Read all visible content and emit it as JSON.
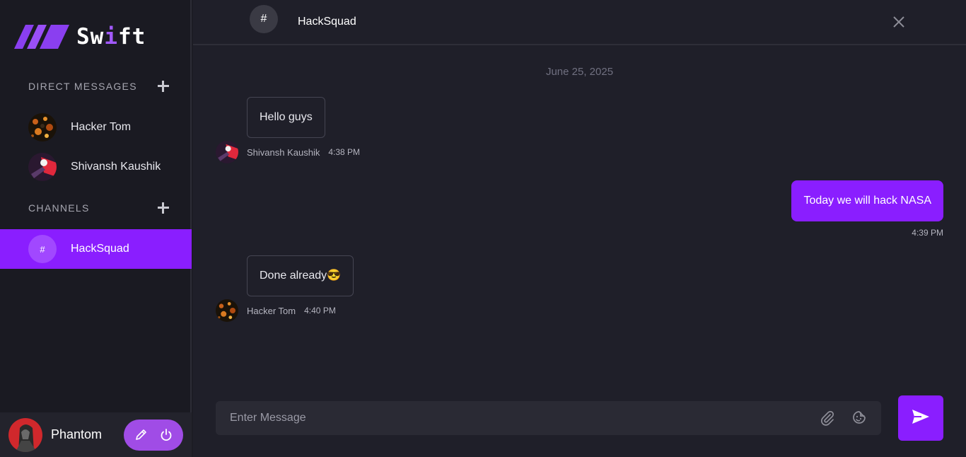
{
  "app": {
    "logo_prefix": "Sw",
    "logo_accent": "i",
    "logo_suffix": "ft",
    "accent_color": "#8a1eff"
  },
  "sidebar": {
    "direct_messages_title": "DIRECT MESSAGES",
    "dms": [
      {
        "name": "Hacker Tom",
        "avatar": "hacker-tom-avatar"
      },
      {
        "name": "Shivansh Kaushik",
        "avatar": "shivansh-avatar"
      }
    ],
    "channels_title": "CHANNELS",
    "channels": [
      {
        "icon": "#",
        "name": "HackSquad",
        "active": true
      }
    ],
    "user": {
      "name": "Phantom",
      "avatar": "phantom-avatar"
    }
  },
  "chat": {
    "header_icon": "#",
    "header_title": "HackSquad",
    "date": "June 25, 2025",
    "messages": [
      {
        "text": "Hello guys",
        "sender": "Shivansh Kaushik",
        "time": "4:38 PM",
        "outgoing": false
      },
      {
        "text": "Today we will hack NASA",
        "sender": "",
        "time": "4:39 PM",
        "outgoing": true
      },
      {
        "text": "Done already😎",
        "sender": "Hacker Tom",
        "time": "4:40 PM",
        "outgoing": false
      }
    ],
    "composer_placeholder": "Enter Message"
  },
  "icons": {
    "add_dm": "plus-icon",
    "add_channel": "plus-icon",
    "edit": "pencil-icon",
    "logout": "power-icon",
    "close": "close-icon",
    "attach": "paperclip-icon",
    "emoji": "emoji-icon",
    "send": "send-icon"
  }
}
